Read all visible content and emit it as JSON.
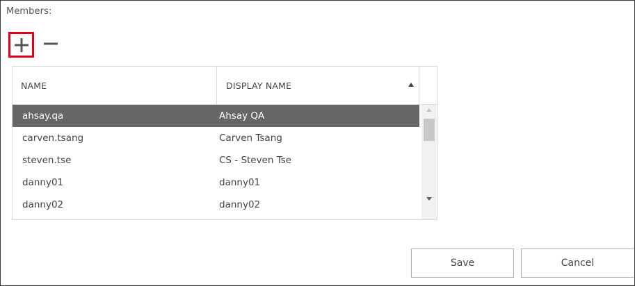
{
  "members": {
    "label": "Members:",
    "add_icon": "plus-icon",
    "remove_icon": "minus-icon",
    "accent_color": "#e0001b"
  },
  "table": {
    "columns": [
      "NAME",
      "DISPLAY NAME"
    ],
    "sort": {
      "column": "DISPLAY NAME",
      "direction": "ascending",
      "icon": "sort-up-icon"
    },
    "rows": [
      {
        "name": "ahsay.qa",
        "display_name": "Ahsay QA",
        "selected": true
      },
      {
        "name": "carven.tsang",
        "display_name": "Carven Tsang",
        "selected": false
      },
      {
        "name": "steven.tse",
        "display_name": "CS - Steven Tse",
        "selected": false
      },
      {
        "name": "danny01",
        "display_name": "danny01",
        "selected": false
      },
      {
        "name": "danny02",
        "display_name": "danny02",
        "selected": false
      }
    ],
    "selected_row_color": "#666666"
  },
  "actions": {
    "save_label": "Save",
    "cancel_label": "Cancel"
  }
}
